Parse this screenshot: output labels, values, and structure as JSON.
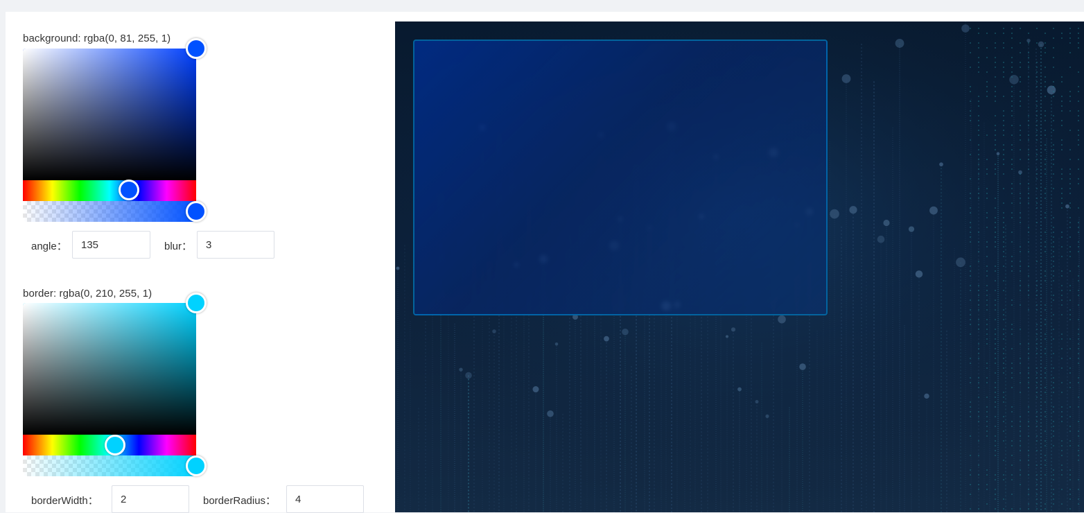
{
  "background": {
    "label": "background: rgba(0, 81, 255, 1)",
    "color": "#0051ff",
    "base_hue": "#0040ff",
    "angle_label": "angle：",
    "angle_value": "135",
    "blur_label": "blur：",
    "blur_value": "3"
  },
  "border": {
    "label": "border: rgba(0, 210, 255, 1)",
    "color": "#00d2ff",
    "base_hue": "#00d2ff",
    "width_label": "borderWidth：",
    "width_value": "2",
    "radius_label": "borderRadius：",
    "radius_value": "4"
  },
  "preview": {
    "accent": "#0a3a8c"
  }
}
